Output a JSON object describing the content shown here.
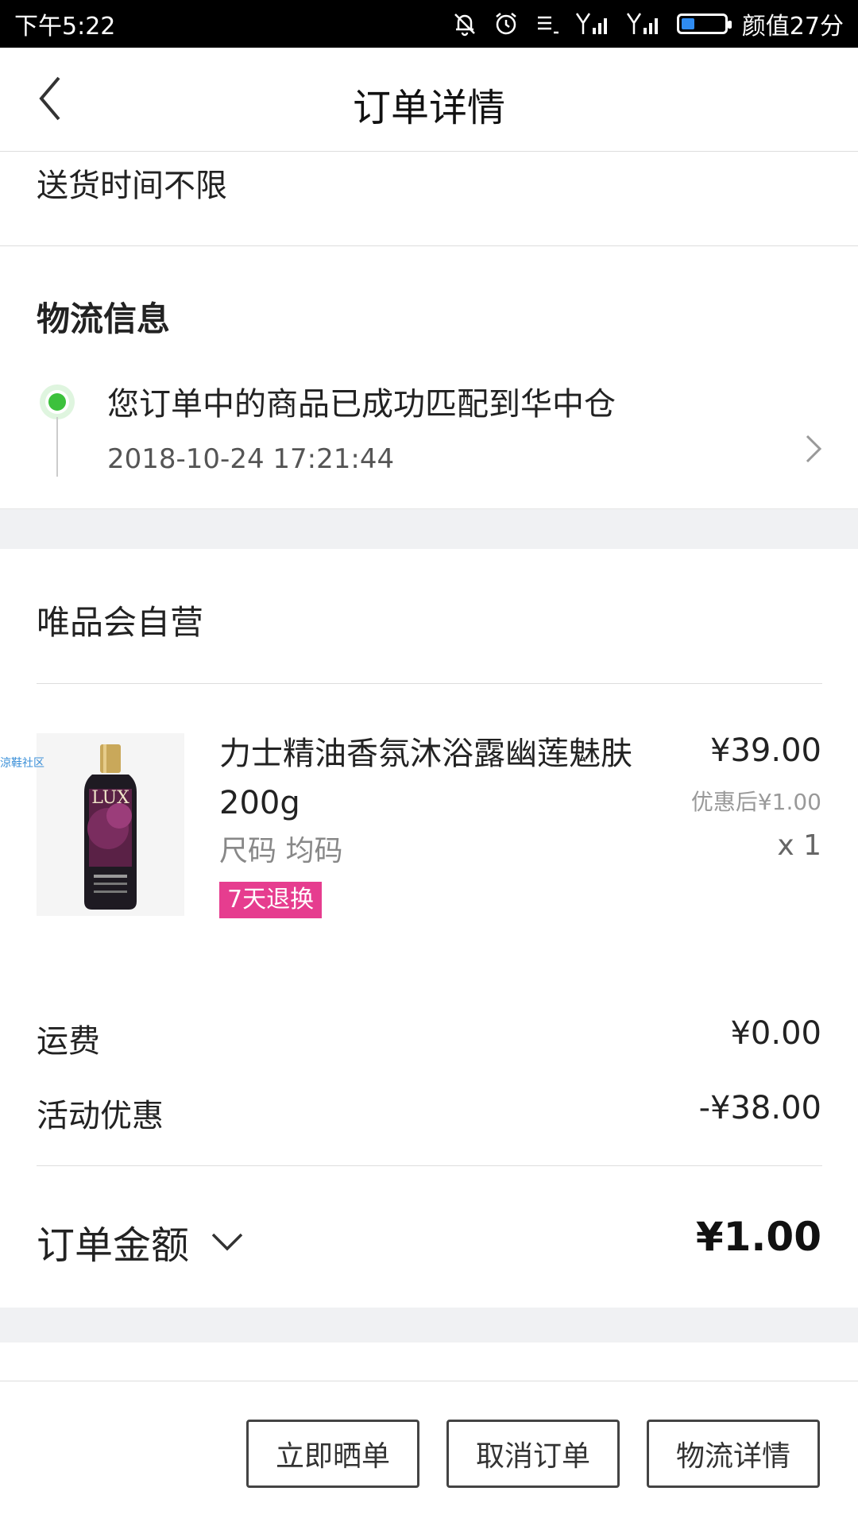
{
  "status_bar": {
    "time": "下午5:22",
    "carrier": "颜值27分",
    "battery_level": 0.3,
    "icons": [
      "mute-bell-icon",
      "alarm-icon",
      "notification-list-icon",
      "signal-icon",
      "signal-icon",
      "battery-icon"
    ]
  },
  "header": {
    "title": "订单详情"
  },
  "delivery": {
    "text": "送货时间不限"
  },
  "logistics": {
    "title": "物流信息",
    "message": "您订单中的商品已成功匹配到华中仓",
    "time": "2018-10-24 17:21:44"
  },
  "store": {
    "name": "唯品会自营"
  },
  "product": {
    "name": "力士精油香氛沐浴露幽莲魅肤200g",
    "spec": "尺码 均码",
    "badge": "7天退换",
    "price": "¥39.00",
    "discount_price": "优惠后¥1.00",
    "quantity": "x 1",
    "image_watermark": "涼鞋社区",
    "brand_text": "LUX"
  },
  "fees": [
    {
      "label": "运费",
      "value": "¥0.00"
    },
    {
      "label": "活动优惠",
      "value": "-¥38.00"
    }
  ],
  "total": {
    "label": "订单金额",
    "value": "¥1.00"
  },
  "actions": [
    {
      "label": "立即晒单"
    },
    {
      "label": "取消订单"
    },
    {
      "label": "物流详情"
    }
  ],
  "colors": {
    "badge": "#e63d8f",
    "timeline_dot": "#3cc13c"
  }
}
